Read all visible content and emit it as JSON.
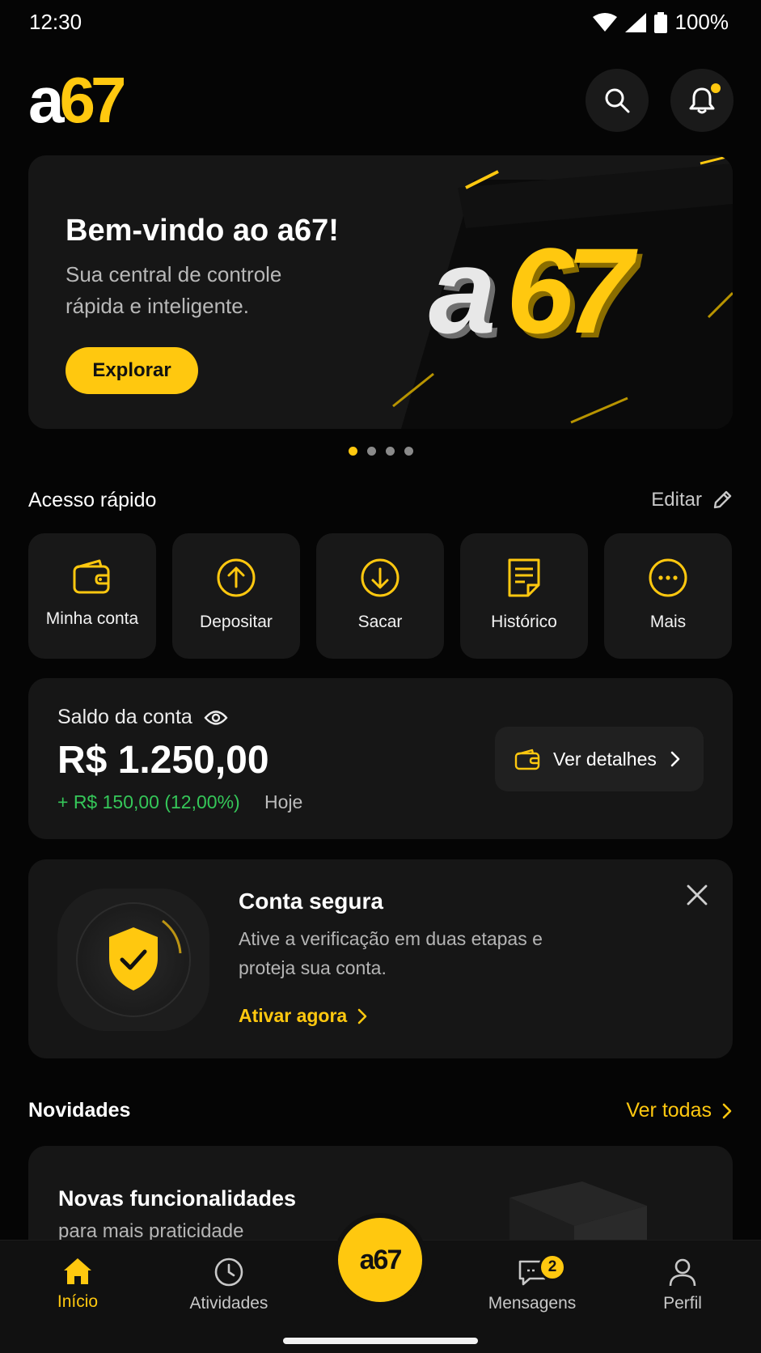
{
  "status_bar": {
    "time": "12:30",
    "battery": "100%"
  },
  "header": {
    "logo_a": "a",
    "logo_num": "67",
    "search_icon": "search-icon",
    "bell_icon": "bell-icon"
  },
  "hero": {
    "title": "Bem-vindo ao a67!",
    "subtitle": "Sua central de controle rápida e inteligente.",
    "button": "Explorar",
    "art_text_a": "a",
    "art_text_num": "67"
  },
  "quick_access": {
    "title": "Acesso rápido",
    "edit": "Editar",
    "items": [
      {
        "label": "Minha conta",
        "icon": "wallet-icon"
      },
      {
        "label": "Depositar",
        "icon": "arrow-up-circle-icon"
      },
      {
        "label": "Sacar",
        "icon": "arrow-down-circle-icon"
      },
      {
        "label": "Histórico",
        "icon": "document-icon"
      },
      {
        "label": "Mais",
        "icon": "more-icon"
      }
    ]
  },
  "balance": {
    "label": "Saldo da conta",
    "value": "R$ 1.250,00",
    "change": "+ R$ 150,00 (12,00%)",
    "period": "Hoje",
    "details_button": "Ver detalhes"
  },
  "security": {
    "title": "Conta segura",
    "subtitle": "Ative a verificação em duas etapas e proteja sua conta.",
    "link": "Ativar agora"
  },
  "news": {
    "title": "Novidades",
    "see_all": "Ver todas",
    "card_title": "Novas funcionalidades",
    "card_subtitle": "para mais praticidade"
  },
  "bottom_nav": {
    "items": [
      "Início",
      "Atividades",
      "Mensagens",
      "Perfil"
    ],
    "center": "a67",
    "messages_badge": "2"
  },
  "colors": {
    "accent": "#ffc80f",
    "positive": "#35c759",
    "background": "#050505",
    "card": "#161616"
  }
}
